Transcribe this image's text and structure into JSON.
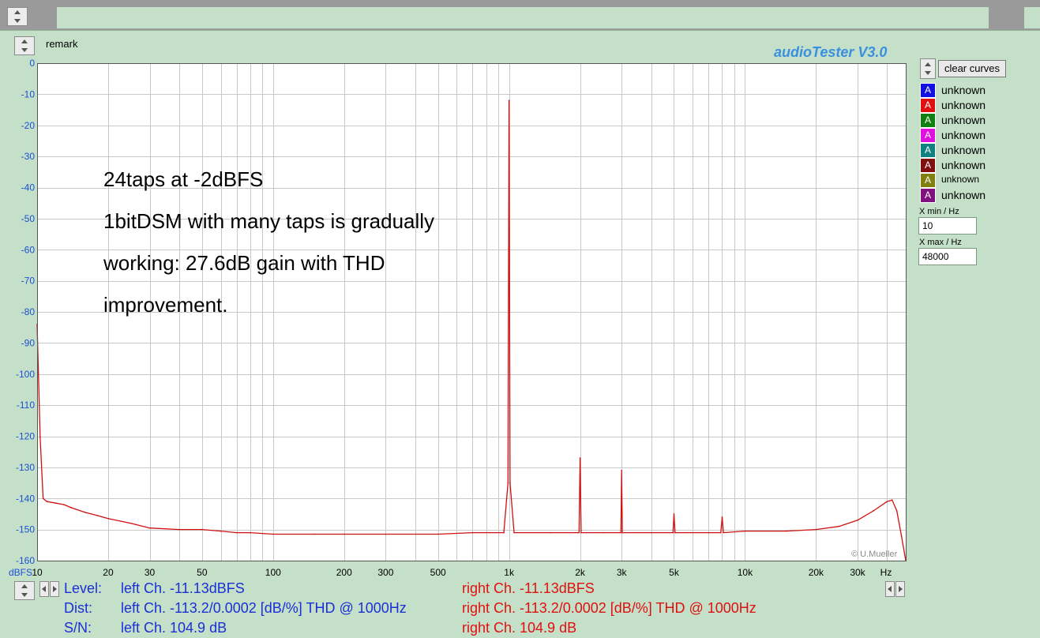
{
  "toolbar": {
    "remark_label": "remark"
  },
  "app_title": "audioTester  V3.0",
  "clear_curves_label": "clear curves",
  "curves": [
    {
      "label": "unknown",
      "color": "#1010e0"
    },
    {
      "label": "unknown",
      "color": "#e01010"
    },
    {
      "label": "unknown",
      "color": "#108010"
    },
    {
      "label": "unknown",
      "color": "#e010e0"
    },
    {
      "label": "unknown",
      "color": "#108080"
    },
    {
      "label": "unknown",
      "color": "#801010"
    },
    {
      "label": "unknown",
      "color": "#808010"
    },
    {
      "label": "unknown",
      "color": "#801080"
    }
  ],
  "xmin": {
    "label": "X min / Hz",
    "value": "10"
  },
  "xmax": {
    "label": "X max / Hz",
    "value": "48000"
  },
  "annotation": {
    "line1": "24taps at -2dBFS",
    "line2": "1bitDSM with many taps is gradually",
    "line3": "working: 27.6dB gain with THD",
    "line4": "improvement."
  },
  "copyright": "© U.Mueller",
  "status": {
    "level_label": "Level:",
    "dist_label": "Dist:",
    "sn_label": "S/N:",
    "left_level": "left Ch. -11.13dBFS",
    "right_level": "right Ch. -11.13dBFS",
    "left_dist": "left Ch. -113.2/0.0002 [dB/%] THD @ 1000Hz",
    "right_dist": "right Ch. -113.2/0.0002 [dB/%] THD @ 1000Hz",
    "left_sn": "left Ch. 104.9 dB",
    "right_sn": "right Ch. 104.9 dB"
  },
  "chart_data": {
    "type": "line",
    "title": "",
    "xlabel": "Hz",
    "ylabel": "dBFS",
    "x_scale": "log",
    "xlim": [
      10,
      48000
    ],
    "ylim": [
      -160,
      0
    ],
    "grid": true,
    "y_ticks": [
      0,
      -10,
      -20,
      -30,
      -40,
      -50,
      -60,
      -70,
      -80,
      -90,
      -100,
      -110,
      -120,
      -130,
      -140,
      -150,
      -160
    ],
    "y_tick_labels": [
      "0",
      "-10",
      "-20",
      "-30",
      "-40",
      "-50",
      "-60",
      "-70",
      "-80",
      "-90",
      "-100",
      "-110",
      "-120",
      "-130",
      "-140",
      "-150",
      "-160"
    ],
    "x_ticks": [
      10,
      20,
      30,
      50,
      100,
      200,
      300,
      500,
      1000,
      2000,
      3000,
      5000,
      10000,
      20000,
      30000
    ],
    "x_tick_labels": [
      "10",
      "20",
      "30",
      "50",
      "100",
      "200",
      "300",
      "500",
      "1k",
      "2k",
      "3k",
      "5k",
      "10k",
      "20k",
      "30k"
    ],
    "series": [
      {
        "color": "#d01010",
        "x": [
          10,
          10.3,
          10.6,
          11,
          12,
          13,
          14,
          16,
          18,
          20,
          25,
          30,
          40,
          50,
          60,
          70,
          80,
          100,
          150,
          200,
          300,
          500,
          700,
          950,
          990,
          1000,
          1010,
          1050,
          1500,
          1980,
          2000,
          2020,
          2500,
          2980,
          3000,
          3020,
          4000,
          4950,
          5000,
          5050,
          7000,
          7900,
          8000,
          8100,
          10000,
          15000,
          20000,
          25000,
          30000,
          35000,
          40000,
          42000,
          44000,
          46000,
          48000
        ],
        "y": [
          -84,
          -120,
          -140,
          -141,
          -141.5,
          -142,
          -143,
          -144.5,
          -145.5,
          -146.5,
          -148,
          -149.5,
          -150,
          -150,
          -150.5,
          -151,
          -151,
          -151.5,
          -151.5,
          -151.5,
          -151.5,
          -151.5,
          -151,
          -151,
          -135,
          -12,
          -135,
          -151,
          -151,
          -151,
          -127,
          -151,
          -151,
          -151,
          -131,
          -151,
          -151,
          -151,
          -145,
          -151,
          -151,
          -151,
          -146,
          -151,
          -150.5,
          -150.5,
          -150,
          -149,
          -147,
          -144,
          -141,
          -140.5,
          -144,
          -152,
          -160
        ]
      }
    ]
  }
}
